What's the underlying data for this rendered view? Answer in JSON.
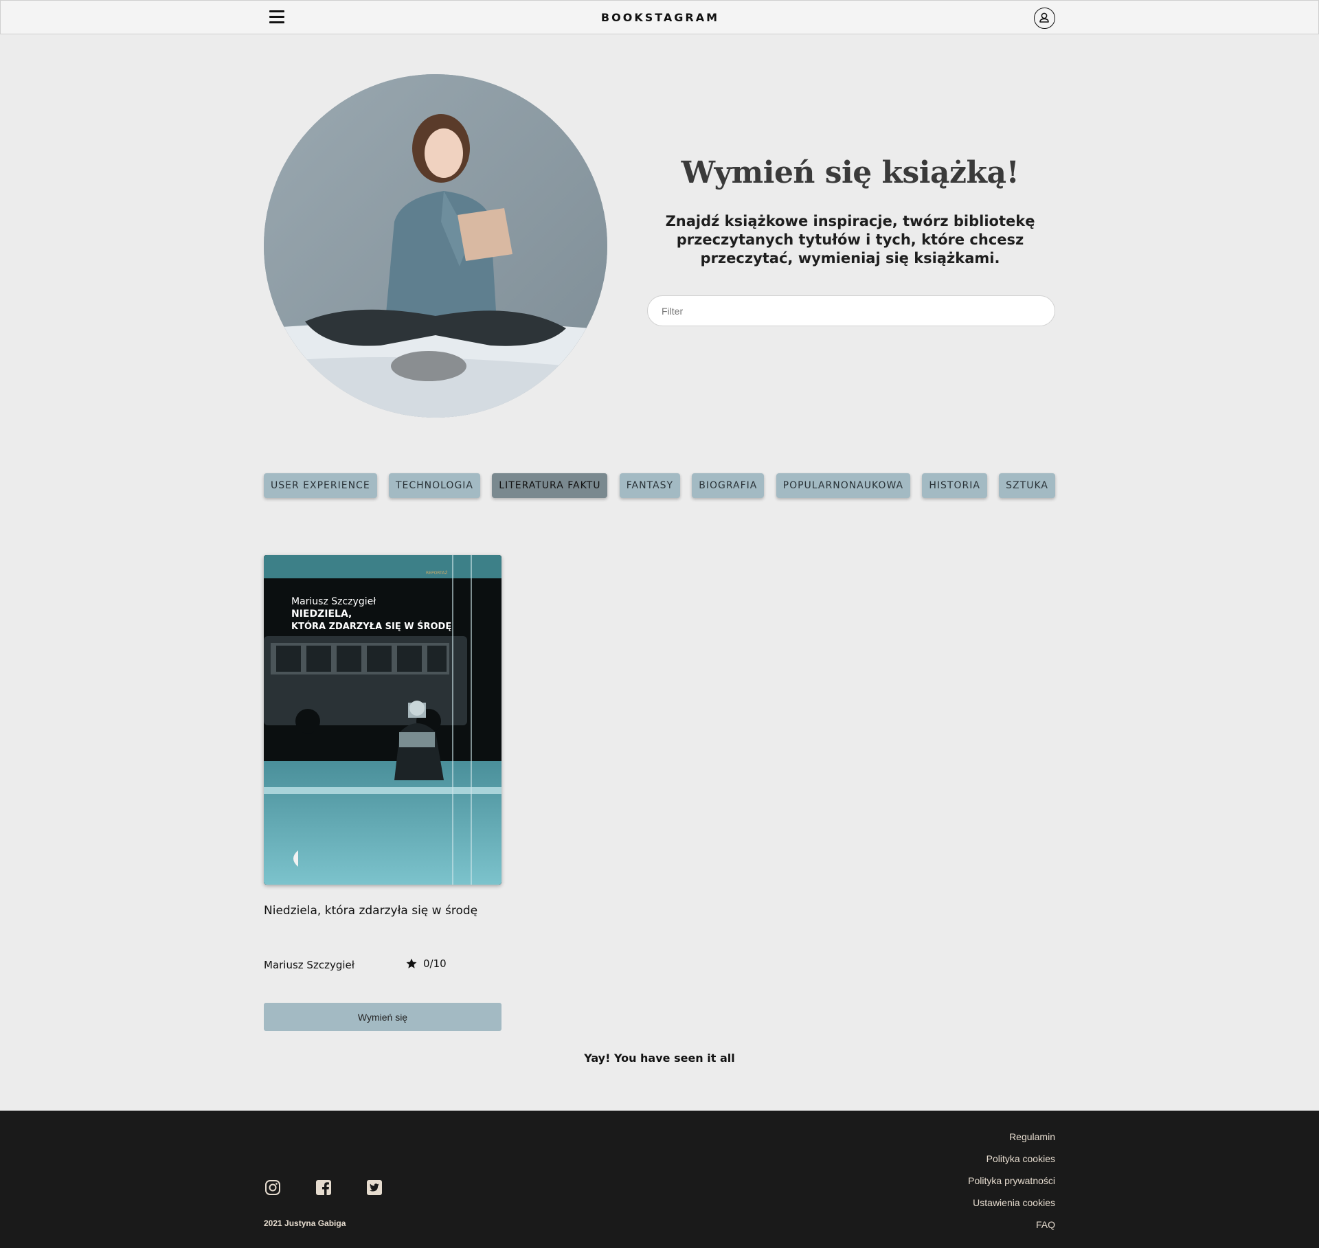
{
  "header": {
    "brand": "BOOKSTAGRAM",
    "menu_icon": "hamburger-menu-icon",
    "user_icon": "user-account-icon"
  },
  "hero": {
    "title": "Wymień się książką!",
    "subtitle": "Znajdź książkowe inspiracje, twórz bibliotekę przeczytanych tytułów i tych, które chcesz przeczytać, wymieniaj się książkami.",
    "filter_placeholder": "Filter",
    "filter_value": ""
  },
  "categories": [
    {
      "label": "USER EXPERIENCE",
      "active": false
    },
    {
      "label": "TECHNOLOGIA",
      "active": false
    },
    {
      "label": "LITERATURA FAKTU",
      "active": true
    },
    {
      "label": "FANTASY",
      "active": false
    },
    {
      "label": "BIOGRAFIA",
      "active": false
    },
    {
      "label": "POPULARNONAUKOWA",
      "active": false
    },
    {
      "label": "HISTORIA",
      "active": false
    },
    {
      "label": "SZTUKA",
      "active": false
    }
  ],
  "books": [
    {
      "cover": {
        "series": "REPORTAŻ",
        "author": "Mariusz Szczygieł",
        "title_line1": "NIEDZIELA,",
        "title_line2": "KTÓRA ZDARZYŁA SIĘ W ŚRODĘ"
      },
      "title": "Niedziela, która zdarzyła się w środę",
      "author": "Mariusz Szczygieł",
      "rating": "0/10",
      "button_label": "Wymień się"
    }
  ],
  "end_message": "Yay! You have seen it all",
  "footer": {
    "social_icons": [
      "instagram-icon",
      "facebook-icon",
      "twitter-icon"
    ],
    "copyright": "2021 Justyna Gabiga",
    "links": [
      "Regulamin",
      "Polityka cookies",
      "Polityka prywatności",
      "Ustawienia cookies",
      "FAQ"
    ]
  },
  "colors": {
    "page_bg": "#ececec",
    "chip": "#a3bac3",
    "chip_active": "#7a898f",
    "footer_bg": "#1a1a1a",
    "footer_text": "#e6dccf"
  }
}
